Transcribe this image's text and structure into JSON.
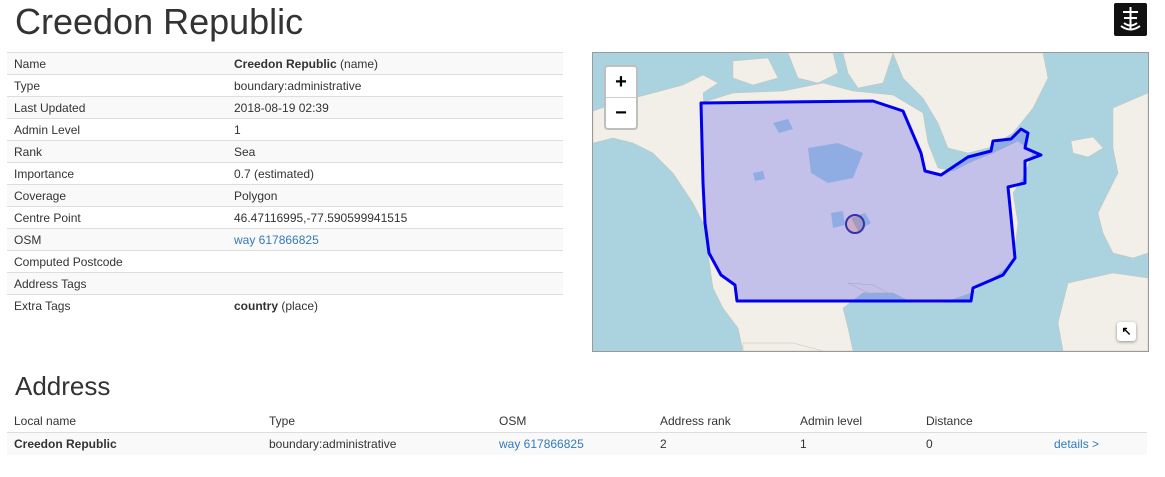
{
  "page": {
    "title": "Creedon Republic"
  },
  "details": [
    {
      "key": "Name",
      "value": "Creedon Republic",
      "suffix": " (name)"
    },
    {
      "key": "Type",
      "value": "boundary:administrative"
    },
    {
      "key": "Last Updated",
      "value": "2018-08-19 02:39"
    },
    {
      "key": "Admin Level",
      "value": "1"
    },
    {
      "key": "Rank",
      "value": "Sea"
    },
    {
      "key": "Importance",
      "value": "0.7 (estimated)"
    },
    {
      "key": "Coverage",
      "value": "Polygon"
    },
    {
      "key": "Centre Point",
      "value": "46.47116995,-77.590599941515"
    },
    {
      "key": "OSM",
      "value": "way 617866825"
    },
    {
      "key": "Computed Postcode",
      "value": ""
    },
    {
      "key": "Address Tags",
      "value": ""
    },
    {
      "key": "Extra Tags",
      "value": "country",
      "suffix": " (place)"
    }
  ],
  "map": {
    "zoom_in": "+",
    "zoom_out": "−",
    "expand_icon": "↖",
    "colors": {
      "water": "#aad3df",
      "land": "#f2efe9",
      "boundary": "#0000ff"
    }
  },
  "address": {
    "heading": "Address",
    "columns": [
      "Local name",
      "Type",
      "OSM",
      "Address rank",
      "Admin level",
      "Distance"
    ],
    "row": {
      "local_name": "Creedon Republic",
      "type": "boundary:administrative",
      "osm": "way 617866825",
      "address_rank": "2",
      "admin_level": "1",
      "distance": "0",
      "details": "details >"
    }
  }
}
